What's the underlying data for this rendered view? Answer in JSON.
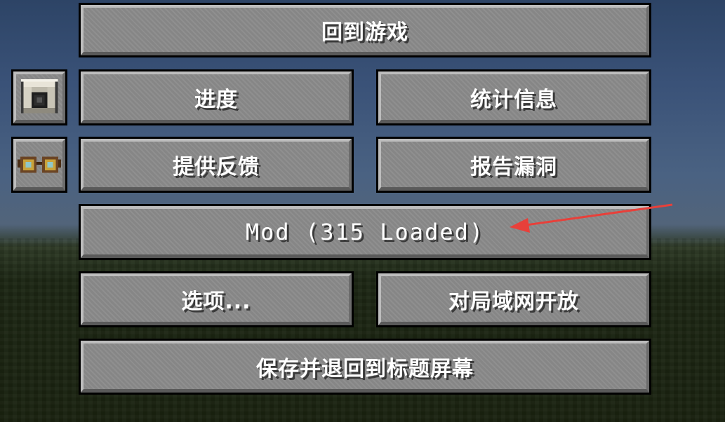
{
  "menu": {
    "back_to_game": "回到游戏",
    "advancements": "进度",
    "statistics": "统计信息",
    "give_feedback": "提供反馈",
    "report_bugs": "报告漏洞",
    "mods": "Mod (315 Loaded)",
    "options": "选项...",
    "open_to_lan": "对局域网开放",
    "save_and_quit": "保存并退回到标题屏幕"
  },
  "icons": {
    "top": "machine-block-icon",
    "bottom": "goggles-icon"
  },
  "colors": {
    "button_face": "#8b8b8b",
    "button_border": "#000000",
    "annotation_arrow": "#e8403a"
  }
}
